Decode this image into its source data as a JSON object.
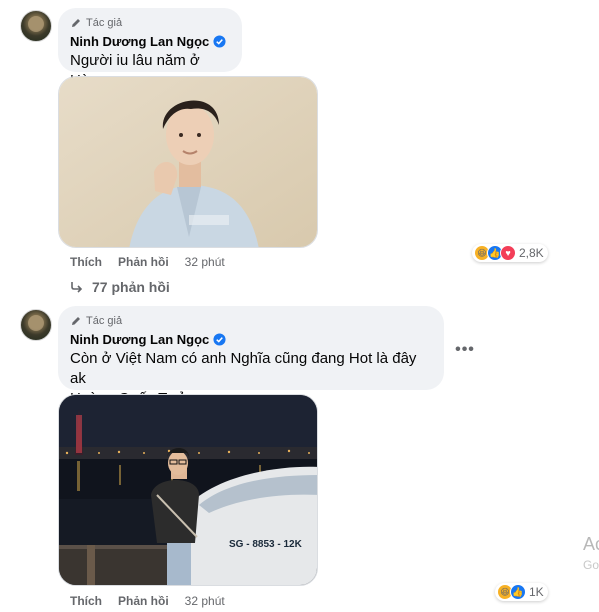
{
  "comments": [
    {
      "badge": "Tác giả",
      "author": "Ninh Dương Lan Ngọc",
      "text_lines": [
        "Người iu lâu năm ở Hàn"
      ],
      "like_label": "Thích",
      "reply_label": "Phản hồi",
      "time": "32 phút",
      "reaction_count": "2,8K",
      "reaction_icons": [
        "haha-icon",
        "like-icon",
        "love-icon"
      ],
      "replies_label": "77 phản hồi"
    },
    {
      "badge": "Tác giả",
      "author": "Ninh Dương Lan Ngọc",
      "text_lines": [
        "Còn ở Việt Nam có anh Nghĩa cũng đang Hot là đây ak",
        "Hoàng Quốc Tưởng"
      ],
      "like_label": "Thích",
      "reply_label": "Phản hồi",
      "time": "32 phút",
      "reaction_count": "1K",
      "reaction_icons": [
        "haha-icon",
        "like-icon"
      ],
      "more_label": "•••"
    }
  ],
  "watermark": {
    "line1": "Ac",
    "line2": "Go"
  },
  "photo2_boat_text": "SG - 8853 - 12K",
  "colors": {
    "verified": "#1877f2",
    "like": "#1877f2",
    "love": "#f33e58",
    "haha": "#f7b125",
    "bubble": "#f0f2f5"
  }
}
